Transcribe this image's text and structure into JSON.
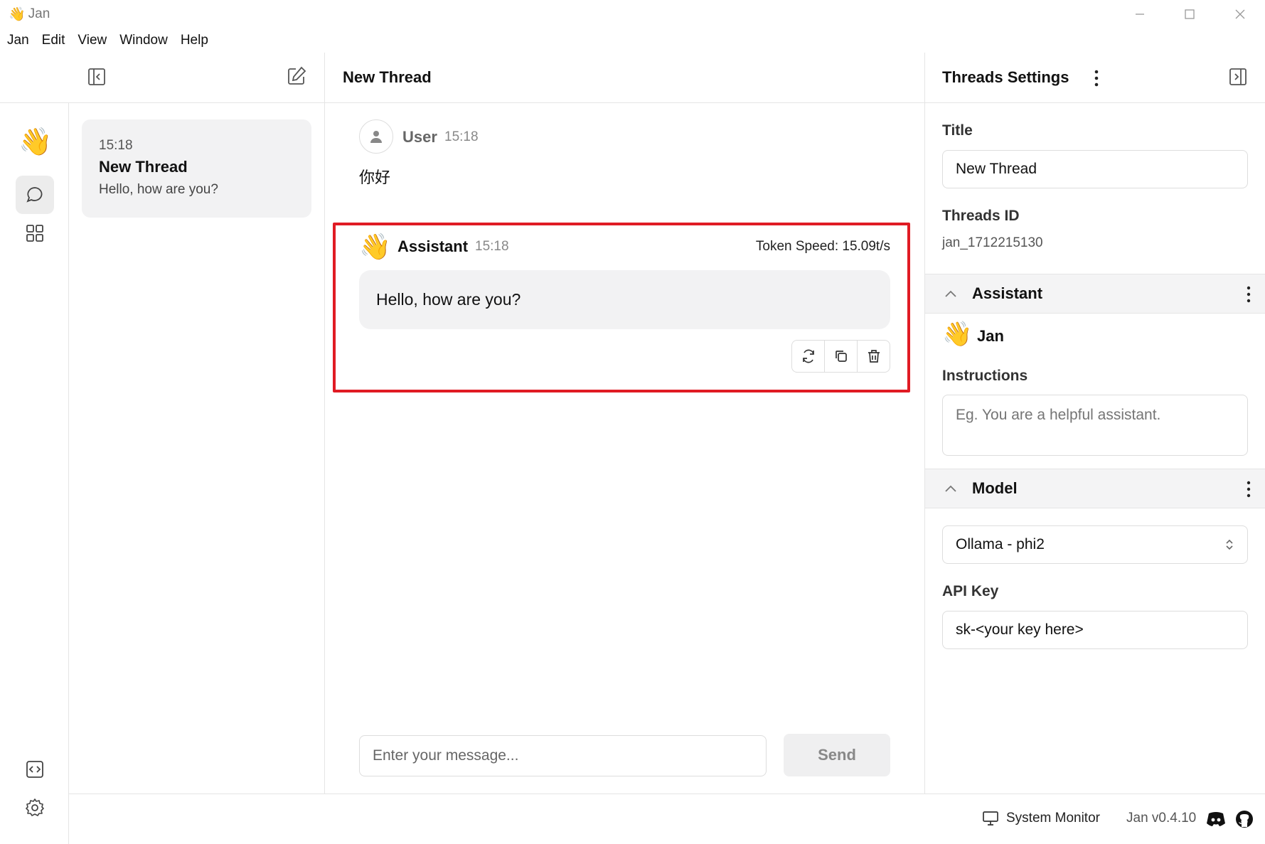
{
  "window": {
    "app_name": "Jan",
    "app_icon": "👋"
  },
  "menu": [
    "Jan",
    "Edit",
    "View",
    "Window",
    "Help"
  ],
  "rail": {
    "logo": "👋",
    "items": [
      "chat-icon",
      "apps-grid-icon"
    ],
    "bottom": [
      "code-icon",
      "settings-icon"
    ]
  },
  "thread_list": {
    "threads": [
      {
        "time": "15:18",
        "title": "New Thread",
        "snippet": "Hello, how are you?"
      }
    ]
  },
  "conversation": {
    "title": "New Thread",
    "user_message": {
      "sender": "User",
      "time": "15:18",
      "text": "你好"
    },
    "assistant_message": {
      "sender": "Assistant",
      "avatar": "👋",
      "time": "15:18",
      "token_speed": "Token Speed: 15.09t/s",
      "text": "Hello, how are you?"
    },
    "input_placeholder": "Enter your message...",
    "send_label": "Send"
  },
  "settings_panel": {
    "title": "Threads Settings",
    "title_label": "Title",
    "title_value": "New Thread",
    "threads_id_label": "Threads ID",
    "threads_id_value": "jan_1712215130",
    "assistant_section": "Assistant",
    "assistant_avatar": "👋",
    "assistant_name": "Jan",
    "instructions_label": "Instructions",
    "instructions_placeholder": "Eg. You are a helpful assistant.",
    "model_section": "Model",
    "model_value": "Ollama - phi2",
    "api_key_label": "API Key",
    "api_key_value": "sk-<your key here>"
  },
  "footer": {
    "system_monitor": "System Monitor",
    "version": "Jan v0.4.10"
  },
  "colors": {
    "highlight": "#e01b24",
    "card_bg": "#f2f2f3",
    "border": "#e5e5e5"
  }
}
